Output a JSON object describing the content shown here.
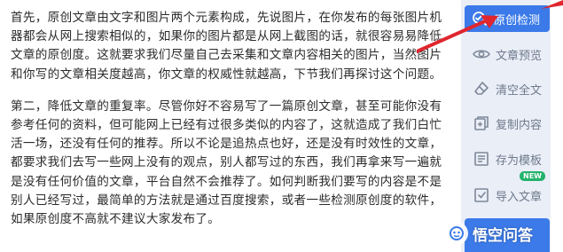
{
  "article": {
    "paragraphs": [
      "首先，原创文章由文字和图片两个元素构成，先说图片，在你发布的每张图片机器都会从网上搜索相似的，如果你的图片都是从网上截图的话，就很容易易降低文章的原创度。这就要求我们尽量自己去采集和文章内容相关的图片，当然图片和你写的文章相关度越高，你文章的权威性就越高，下节我们再探讨这个问题。",
      "第二，降低文章的重复率。尽管你好不容易写了一篇原创文章，甚至可能你没有参考任何的资料，但可能网上已经有过很多类似的内容了，这就造成了我们白忙活一场，还没有任何的推荐。所以不论是追热点也好，还是没有时效性的文章，都要求我们去写一些网上没有的观点，别人都写过的东西，我们再拿来写一遍就是没有任何价值的文章，平台自然不会推荐了。如何判断我们要写的内容是不是别人已经写过，最简单的方法就是通过百度搜索，或者一些检测原创度的软件，如果原创度不高就不建议大家发布了。"
    ]
  },
  "toolbar": {
    "items": [
      {
        "label": "原创检测",
        "icon": "search-check-icon"
      },
      {
        "label": "文章预览",
        "icon": "eye-icon"
      },
      {
        "label": "清空全文",
        "icon": "eraser-icon"
      },
      {
        "label": "复制内容",
        "icon": "copy-icon"
      },
      {
        "label": "存为模板",
        "icon": "template-icon"
      },
      {
        "label": "导入文章",
        "icon": "import-icon"
      }
    ],
    "new_badge": "NEW",
    "accent_color": "#3b7ae8"
  },
  "watermark": {
    "text": "悟空问答"
  }
}
